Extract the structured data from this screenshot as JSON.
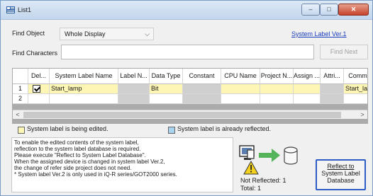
{
  "window": {
    "title": "List1",
    "minimize": "–",
    "maximize": "□",
    "close": "✕"
  },
  "toolbar": {
    "find_object_label": "Find Object",
    "find_object_value": "Whole Display",
    "system_label_link": "System Label Ver.1",
    "find_characters_label": "Find Characters",
    "find_characters_value": "",
    "find_next_label": "Find Next"
  },
  "grid": {
    "columns": [
      "",
      "Del...",
      "System Label Name",
      "Label N...",
      "Data Type",
      "Constant",
      "CPU Name",
      "Project N...",
      "Assign ...",
      "Attri...",
      "Comm"
    ],
    "rows": [
      {
        "num": "1",
        "checked": true,
        "name": "Start_lamp",
        "label_n": "",
        "data_type": "Bit",
        "constant": "",
        "cpu_name": "",
        "project": "",
        "assign": "",
        "attri": "",
        "comment": "Start_la"
      },
      {
        "num": "2",
        "checked": false,
        "name": "",
        "label_n": "",
        "data_type": "",
        "constant": "",
        "cpu_name": "",
        "project": "",
        "assign": "",
        "attri": "",
        "comment": ""
      }
    ],
    "scroll_left": "<",
    "scroll_right": ">"
  },
  "legend": {
    "editing": "System label is being edited.",
    "reflected": "System label is already reflected.",
    "editing_color": "#fdf6b4",
    "reflected_color": "#a9d5ef"
  },
  "info": {
    "lines": [
      "To enable the edited contents of the system label,",
      "reflection to the system label database is required.",
      "Please execute \"Reflect to System Label Database\".",
      "When the assigned device is changed in system label Ver.2,",
      "the change of refer side project does not need.",
      "* System label Ver.2 is only used in iQ-R series/GOT2000 series."
    ]
  },
  "status": {
    "not_reflected": "Not Reflected: 1",
    "total": "Total: 1"
  },
  "reflect_button": {
    "line1": "Reflect to",
    "line2": "System Label",
    "line3": "Database"
  },
  "colors": {
    "edited_row": "#fdf6b4",
    "readonly_cell": "#cfcfcf",
    "accent_link": "#1a3dbd"
  }
}
